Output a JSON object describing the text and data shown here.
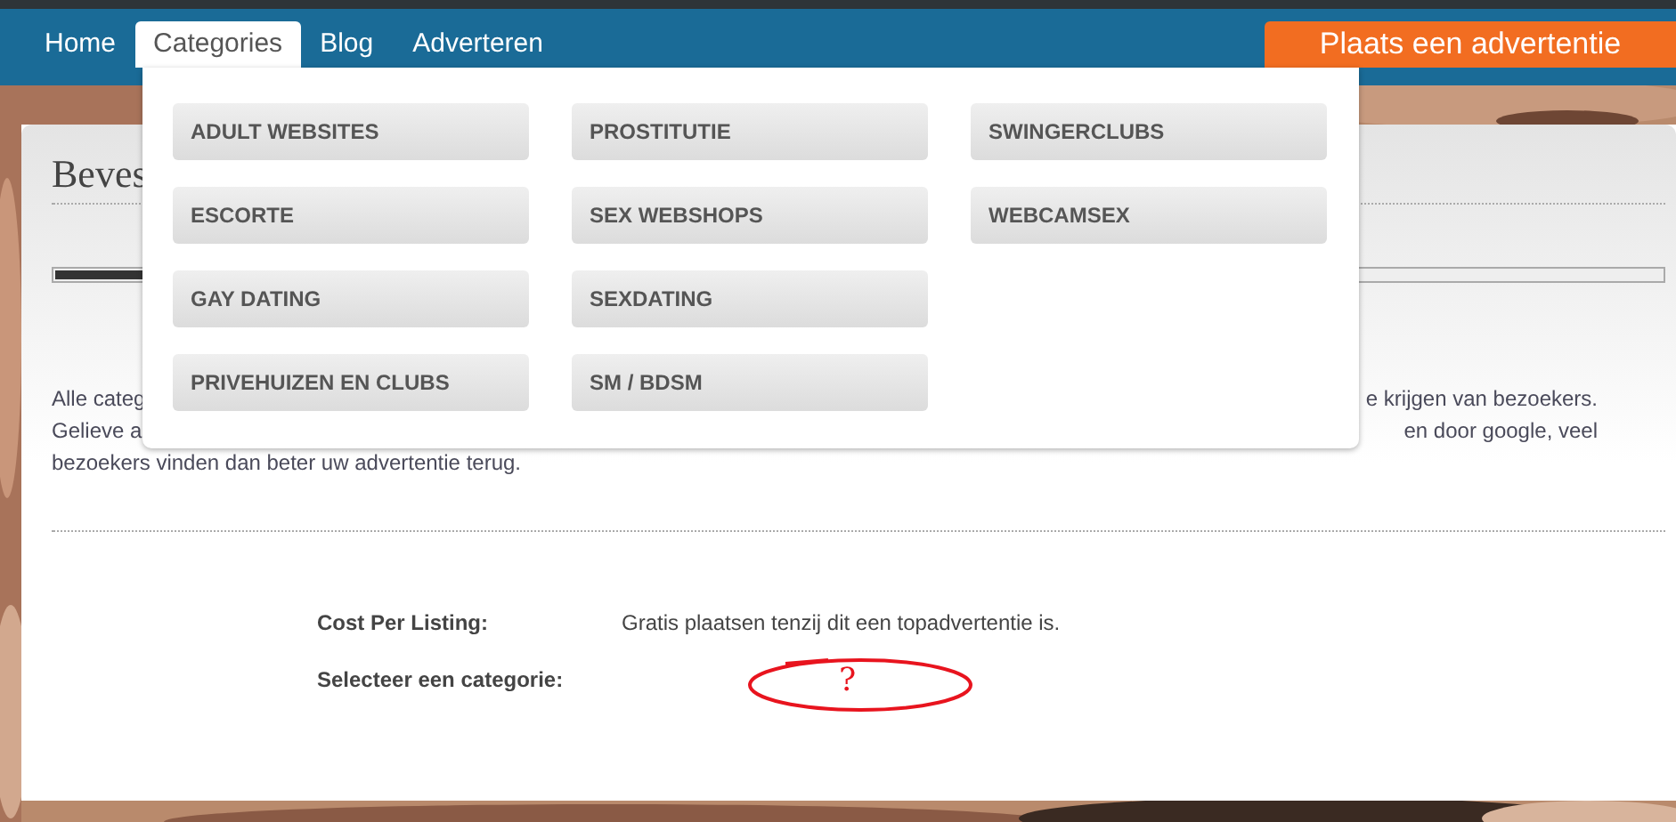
{
  "nav": {
    "items": [
      {
        "label": "Home",
        "selected": false
      },
      {
        "label": "Categories",
        "selected": true
      },
      {
        "label": "Blog",
        "selected": false
      },
      {
        "label": "Adverteren",
        "selected": false
      }
    ],
    "cta": "Plaats een advertentie"
  },
  "dropdown": {
    "columns": [
      [
        "ADULT WEBSITES",
        "ESCORTE",
        "GAY DATING",
        "PRIVEHUIZEN EN CLUBS"
      ],
      [
        "PROSTITUTIE",
        "SEX WEBSHOPS",
        "SEXDATING",
        "SM / BDSM"
      ],
      [
        "SWINGERCLUBS",
        "WEBCAMSEX"
      ]
    ]
  },
  "card": {
    "title": "Beves",
    "progress": {
      "level": 0.3
    },
    "intro": [
      {
        "left": "Alle categ",
        "right": "e krijgen van bezoekers."
      },
      {
        "left": "Gelieve a",
        "right": "en door google, veel"
      },
      {
        "left": "bezoekers vinden dan beter uw advertentie terug."
      }
    ],
    "fields": [
      {
        "label": "Cost Per Listing:",
        "value": "Gratis plaatsen tenzij dit een topadvertentie is."
      },
      {
        "label": "Selecteer een categorie:",
        "annotation": "?"
      }
    ]
  }
}
